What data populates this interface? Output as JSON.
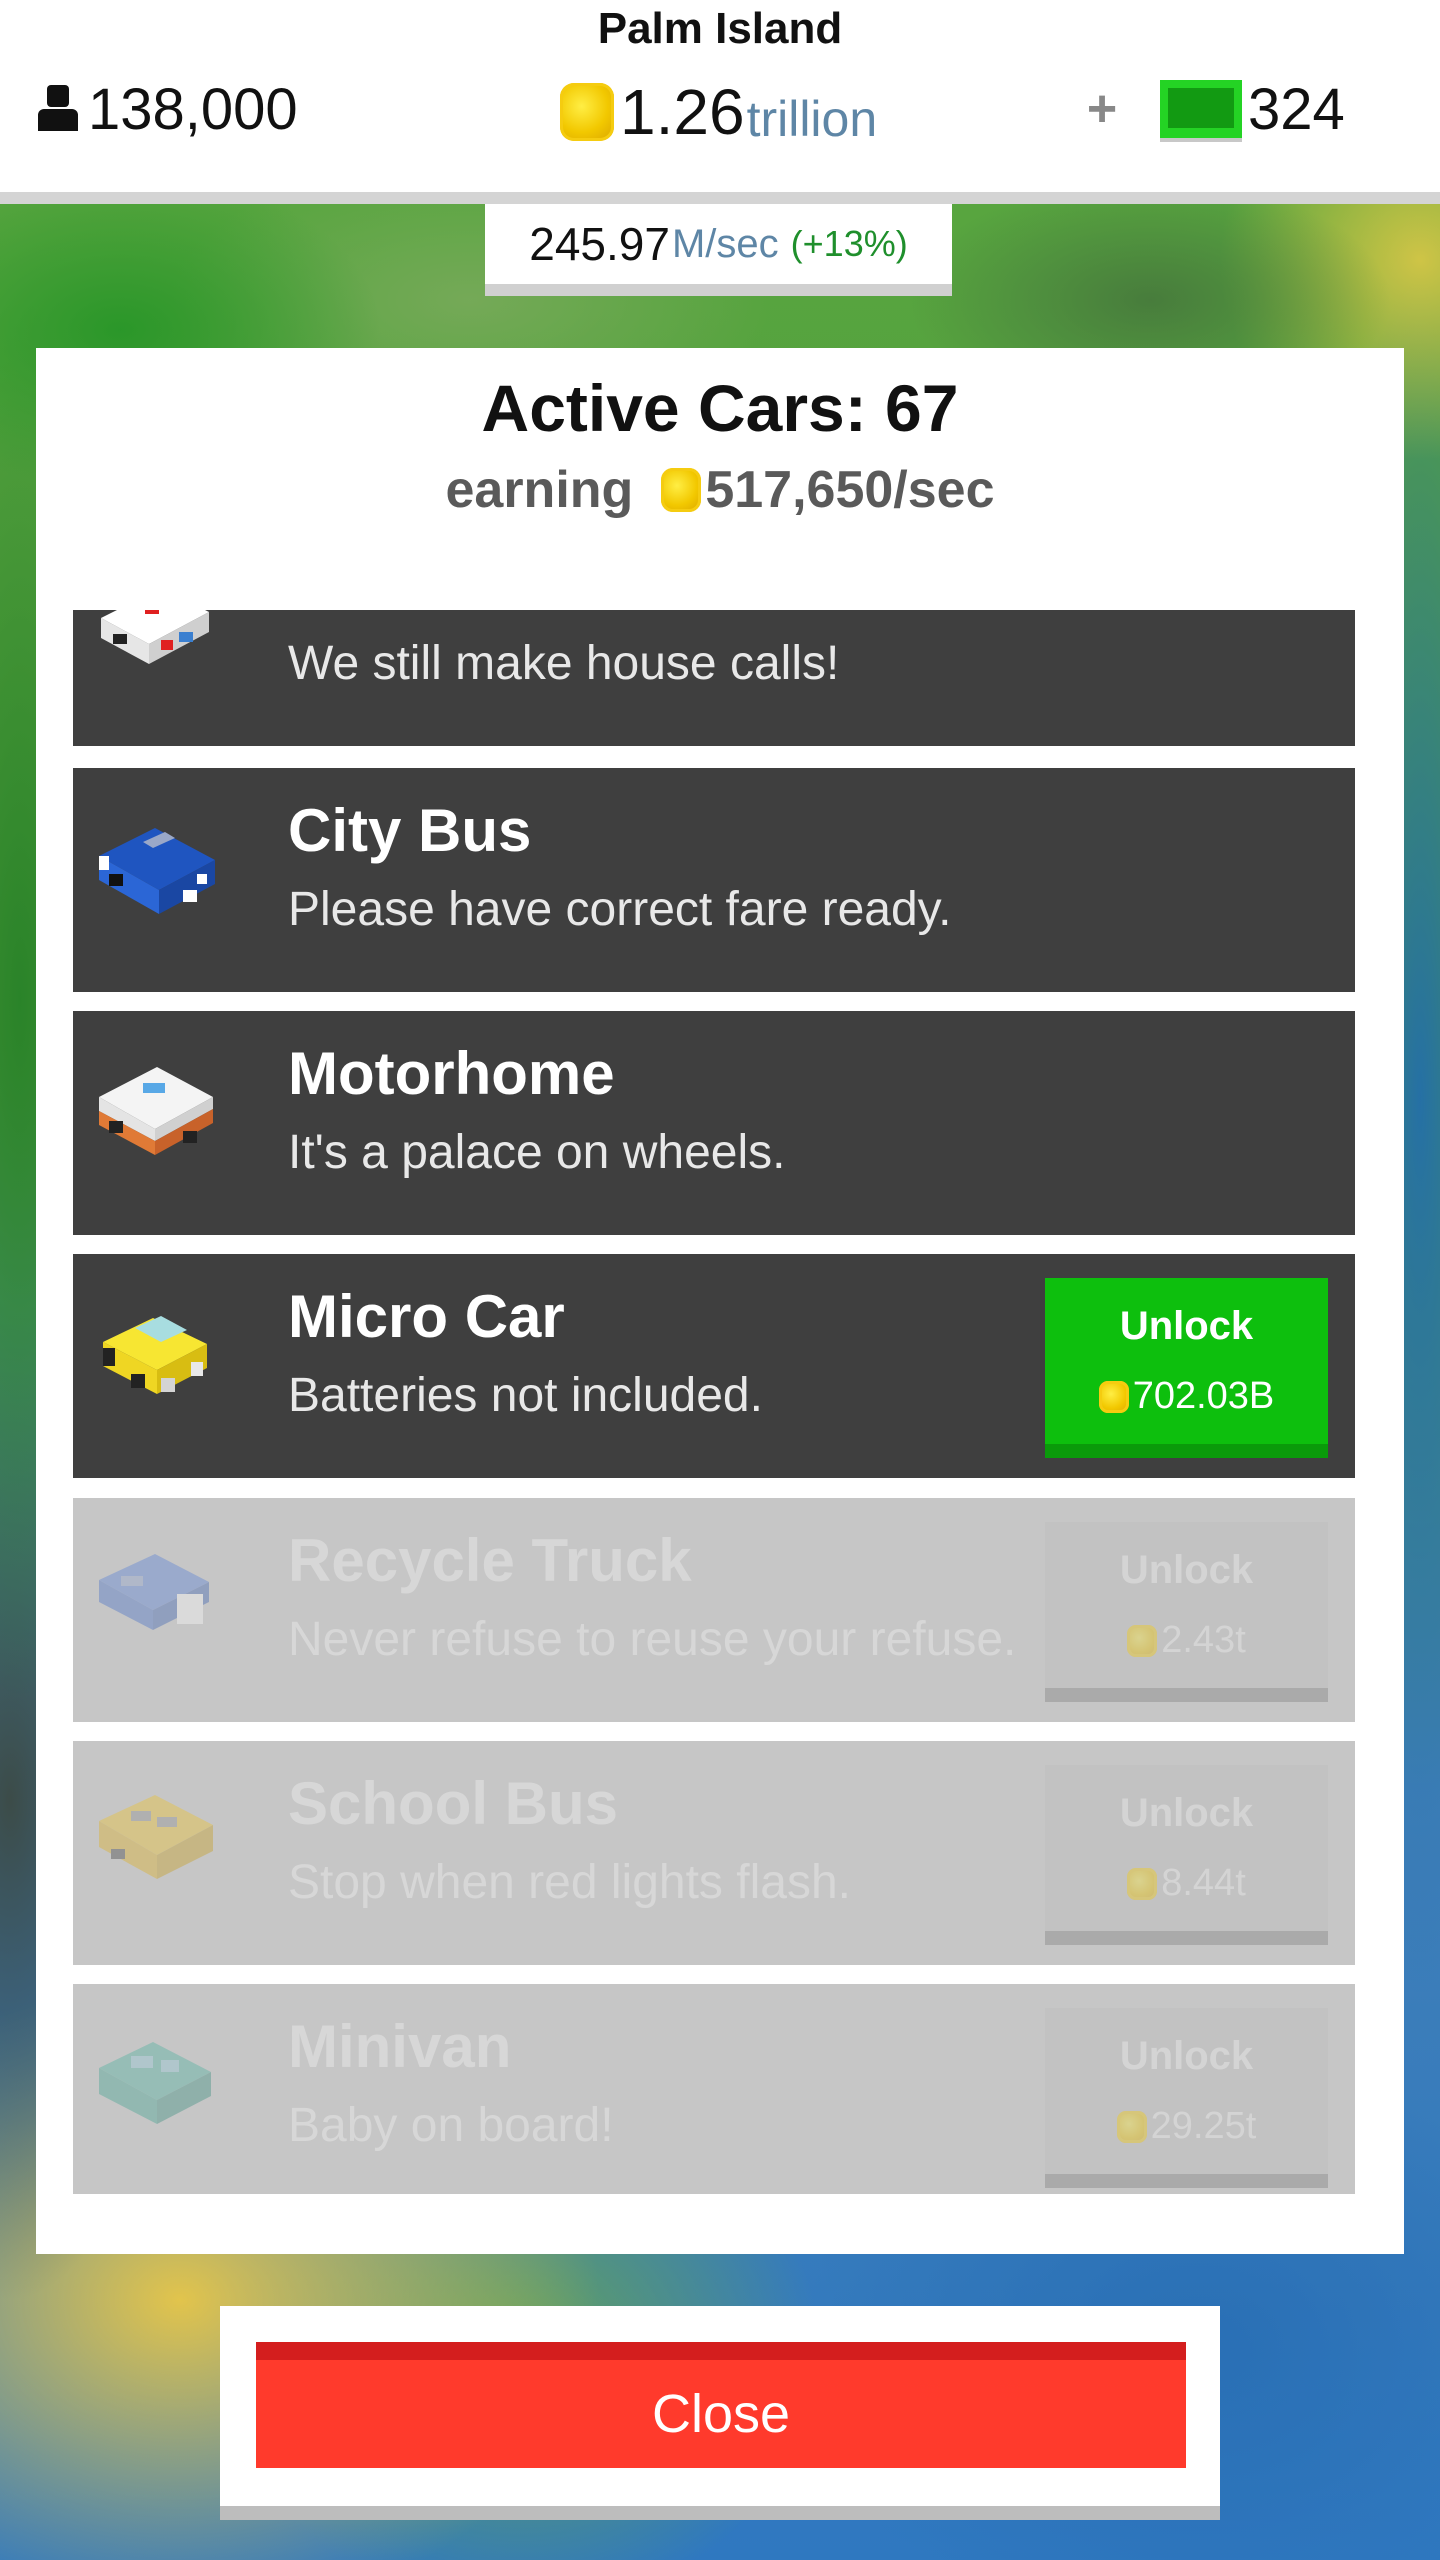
{
  "header": {
    "island_name": "Palm Island",
    "population": "138,000",
    "coins_value": "1.26",
    "coins_unit": "trillion",
    "plus_label": "+",
    "cash": "324",
    "rate_value": "245.97",
    "rate_unit": "M/sec",
    "rate_bonus": "(+13%)"
  },
  "panel": {
    "title": "Active Cars: 67",
    "earning_label": "earning",
    "earning_value": "517,650/sec"
  },
  "cars": [
    {
      "name": "",
      "desc": "We still make house calls!",
      "icon": "ambulance-icon",
      "state": "owned"
    },
    {
      "name": "City Bus",
      "desc": "Please have correct fare ready.",
      "icon": "city-bus-icon",
      "state": "owned"
    },
    {
      "name": "Motorhome",
      "desc": "It's a palace on wheels.",
      "icon": "motorhome-icon",
      "state": "owned"
    },
    {
      "name": "Micro Car",
      "desc": "Batteries not included.",
      "icon": "micro-car-icon",
      "state": "unlockable",
      "unlock_label": "Unlock",
      "price": "702.03B"
    },
    {
      "name": "Recycle Truck",
      "desc": "Never refuse to reuse your refuse.",
      "icon": "recycle-truck-icon",
      "state": "locked",
      "unlock_label": "Unlock",
      "price": "2.43t"
    },
    {
      "name": "School Bus",
      "desc": "Stop when red lights flash.",
      "icon": "school-bus-icon",
      "state": "locked",
      "unlock_label": "Unlock",
      "price": "8.44t"
    },
    {
      "name": "Minivan",
      "desc": "Baby on board!",
      "icon": "minivan-icon",
      "state": "locked",
      "unlock_label": "Unlock",
      "price": "29.25t"
    }
  ],
  "footer": {
    "close_label": "Close"
  },
  "colors": {
    "row_dark": "#3f3f3f",
    "row_locked": "#c6c6c6",
    "unlock_green": "#0dbf0d",
    "close_red": "#ff3a2c",
    "coin_gold": "#f2c800"
  }
}
